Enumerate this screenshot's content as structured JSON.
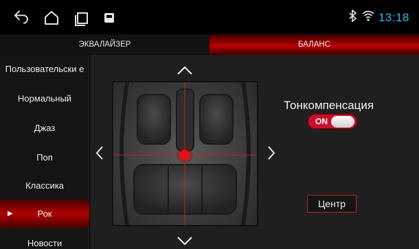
{
  "status_bar": {
    "time": "13:18",
    "icons": [
      "back-icon",
      "home-icon",
      "recent-apps-icon",
      "notification-icon",
      "bluetooth-icon",
      "wifi-icon"
    ]
  },
  "tabs": [
    {
      "label": "ЭКВАЛАЙЗЕР",
      "active": false
    },
    {
      "label": "БАЛАНС",
      "active": true
    }
  ],
  "presets": [
    {
      "label": "Пользовательски е",
      "active": false
    },
    {
      "label": "Нормальный",
      "active": false
    },
    {
      "label": "Джаз",
      "active": false
    },
    {
      "label": "Поп",
      "active": false
    },
    {
      "label": "Классика",
      "active": false
    },
    {
      "label": "Рок",
      "active": true
    },
    {
      "label": "Новости",
      "active": false
    }
  ],
  "balance": {
    "tonekomp_label": "Тонкомпенсация",
    "toggle_state": "ON",
    "center_label": "Центр",
    "fader": 0,
    "balance": 0
  },
  "colors": {
    "accent_red": "#c00000",
    "time_blue": "#35b9e8",
    "toggle_red": "#c8102e"
  }
}
